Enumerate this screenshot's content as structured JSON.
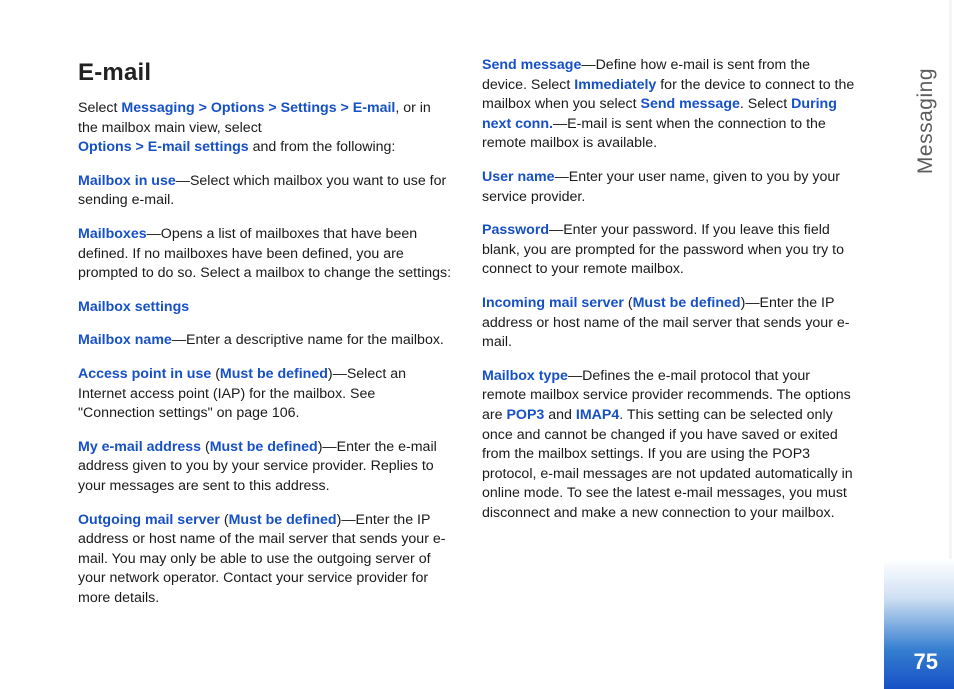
{
  "sideLabel": "Messaging",
  "pageNumber": "75",
  "title": "E-mail",
  "col1": {
    "p1a": "Select ",
    "p1b": "Messaging > Options > Settings > E-mail",
    "p1c": ", or in the mailbox main view, select ",
    "p1d": "Options > E-mail settings",
    "p1e": " and from the following:",
    "p2a": "Mailbox in use",
    "p2b": "—Select which mailbox you want to use for sending e-mail.",
    "p3a": "Mailboxes",
    "p3b": "—Opens a list of mailboxes that have been defined. If no mailboxes have been defined, you are prompted to do so. Select a mailbox to change the settings:",
    "p4": "Mailbox settings",
    "p5a": "Mailbox name",
    "p5b": "—Enter a descriptive name for the mailbox.",
    "p6a": "Access point in use",
    "p6b": " (",
    "p6c": "Must be defined",
    "p6d": ")—Select an Internet access point (IAP) for the mailbox. See \"Connection settings\" on page 106.",
    "p7a": "My e-mail address",
    "p7b": " (",
    "p7c": "Must be defined",
    "p7d": ")—Enter the e-mail address given to you by your service provider. Replies to your messages are sent to this address.",
    "p8a": "Outgoing mail server",
    "p8b": " (",
    "p8c": "Must be defined",
    "p8d": ")—Enter the IP address or host name of the mail server that sends your e-mail. You may only be able to use the outgoing server of your network operator. Contact your service provider for more details."
  },
  "col2": {
    "p1a": "Send message",
    "p1b": "—Define how e-mail is sent from the device. Select ",
    "p1c": "Immediately",
    "p1d": " for the device to connect to the mailbox when you select ",
    "p1e": "Send message",
    "p1f": ". Select ",
    "p1g": "During next conn.",
    "p1h": "—E-mail is sent when the connection to the remote mailbox is available.",
    "p2a": "User name",
    "p2b": "—Enter your user name, given to you by your service provider.",
    "p3a": "Password",
    "p3b": "—Enter your password. If you leave this field blank, you are prompted for the password when you try to connect to your remote mailbox.",
    "p4a": "Incoming mail server",
    "p4b": " (",
    "p4c": "Must be defined",
    "p4d": ")—Enter the IP address or host name of the mail server that sends your e-mail.",
    "p5a": "Mailbox type",
    "p5b": "—Defines the e-mail protocol that your remote mailbox service provider recommends. The options are ",
    "p5c": "POP3",
    "p5d": " and ",
    "p5e": "IMAP4",
    "p5f": ". This setting can be selected only once and cannot be changed if you have saved or exited from the mailbox settings. If you are using the POP3 protocol, e-mail messages are not updated automatically in online mode. To see the latest e-mail messages, you must disconnect and make a new connection to your mailbox."
  }
}
